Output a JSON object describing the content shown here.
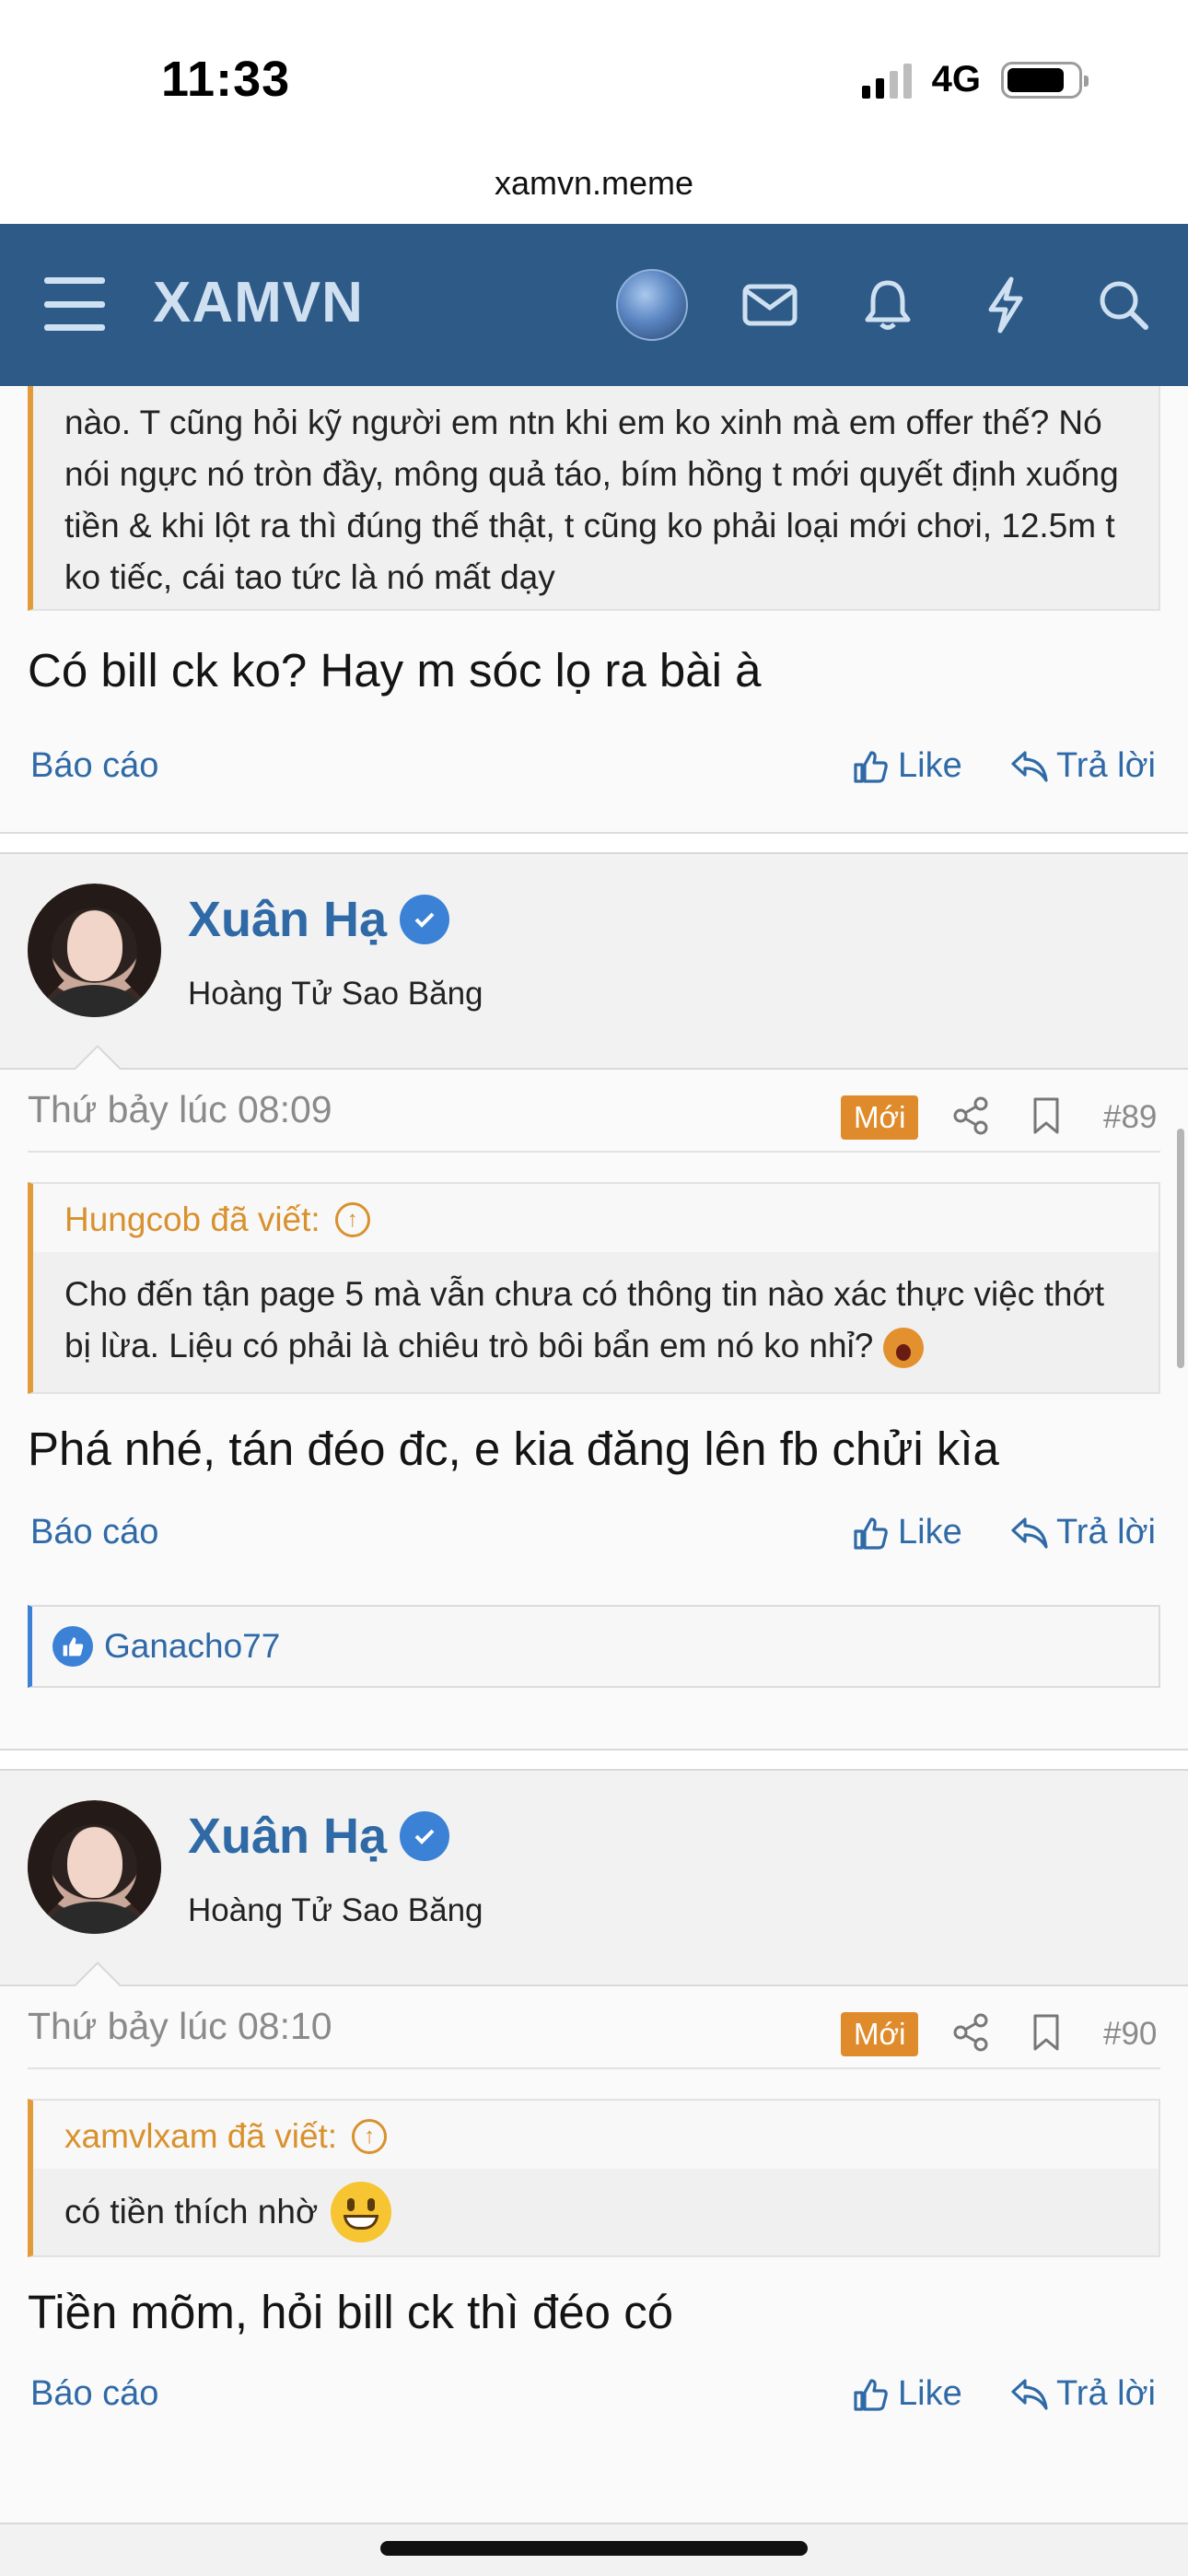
{
  "status_bar": {
    "time": "11:33",
    "network": "4G"
  },
  "browser": {
    "url": "xamvn.meme"
  },
  "nav": {
    "brand": "XAMVN"
  },
  "post_prev": {
    "quote_body": "nào. T cũng hỏi kỹ người em ntn khi em ko xinh mà em offer thế? Nó nói ngực nó tròn đầy, mông quả táo, bím hồng t mới quyết định xuống tiền & khi lột ra thì đúng thế thật, t cũng ko phải loại mới chơi, 12.5m t ko tiếc, cái tao tức là nó mất dạy",
    "message": "Có bill ck ko? Hay m sóc lọ ra bài à",
    "report": "Báo cáo",
    "like": "Like",
    "reply": "Trả lời"
  },
  "post_89": {
    "username": "Xuân Hạ",
    "user_title": "Hoàng Tử Sao Băng",
    "date": "Thứ bảy lúc 08:09",
    "badge": "Mới",
    "number": "#89",
    "quote_author": "Hungcob đã viết:",
    "quote_body": "Cho đến tận page 5 mà vẫn chưa có thông tin nào xác thực việc thớt bị lừa. Liệu có phải là chiêu trò bôi bẩn em nó ko nhỉ?",
    "message": "Phá nhé, tán đéo đc, e kia đăng lên fb chửi kìa",
    "report": "Báo cáo",
    "like": "Like",
    "reply": "Trả lời",
    "reaction_user": "Ganacho77"
  },
  "post_90": {
    "username": "Xuân Hạ",
    "user_title": "Hoàng Tử Sao Băng",
    "date": "Thứ bảy lúc 08:10",
    "badge": "Mới",
    "number": "#90",
    "quote_author": "xamvlxam đã viết:",
    "quote_body": "có tiền thích nhờ",
    "message": "Tiền mõm, hỏi bill ck thì đéo có",
    "report": "Báo cáo",
    "like": "Like",
    "reply": "Trả lời"
  },
  "icons": {
    "menu": "hamburger-icon",
    "mail": "envelope-icon",
    "notifications": "bell-icon",
    "whats_new": "lightning-icon",
    "search": "search-icon",
    "like": "thumbs-up-icon",
    "reply": "reply-arrow-icon",
    "share": "share-icon",
    "bookmark": "bookmark-icon",
    "verified": "verified-check-icon"
  },
  "colors": {
    "nav_bg": "#2d5a87",
    "link": "#2f6aa7",
    "quote_accent": "#e29b3a",
    "badge_new": "#e08b2b",
    "verified": "#3b82d6"
  }
}
